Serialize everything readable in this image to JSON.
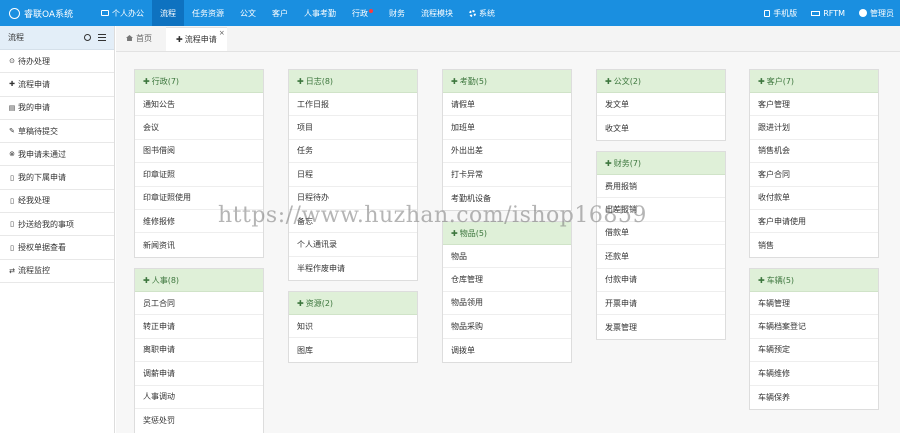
{
  "app": {
    "title": "睿联OA系统"
  },
  "nav": {
    "items": [
      {
        "label": "个人办公",
        "icon": "monitor-icon"
      },
      {
        "label": "流程"
      },
      {
        "label": "任务资源"
      },
      {
        "label": "公文"
      },
      {
        "label": "客户"
      },
      {
        "label": "人事考勤"
      },
      {
        "label": "行政"
      },
      {
        "label": "财务"
      },
      {
        "label": "流程模块"
      },
      {
        "label": "系统",
        "icon": "gear-icon"
      }
    ],
    "right": [
      {
        "label": "手机版",
        "icon": "phone-icon"
      },
      {
        "label": "RFTM",
        "icon": "rftm-icon"
      },
      {
        "label": "管理员",
        "icon": "user-avatar-icon"
      }
    ]
  },
  "sidebar": {
    "title": "流程",
    "items": [
      {
        "label": "待办处理",
        "icon": "⊙"
      },
      {
        "label": "流程申请",
        "icon": "✚"
      },
      {
        "label": "我的申请",
        "icon": "▤"
      },
      {
        "label": "草稿待提交",
        "icon": "✎"
      },
      {
        "label": "我申请未通过",
        "icon": "⊗"
      },
      {
        "label": "我的下属申请",
        "icon": "▯"
      },
      {
        "label": "经我处理",
        "icon": "▯"
      },
      {
        "label": "抄送给我的事项",
        "icon": "▯"
      },
      {
        "label": "授权单据查看",
        "icon": "▯"
      },
      {
        "label": "流程监控",
        "icon": "⇄"
      }
    ]
  },
  "tabs": [
    {
      "label": "首页",
      "icon": "home-icon"
    },
    {
      "label": "流程申请",
      "close": "×"
    }
  ],
  "panels": {
    "xingzheng": {
      "title": "行政(7)",
      "items": [
        "通知公告",
        "会议",
        "图书借阅",
        "印章证照",
        "印章证照使用",
        "维修报修",
        "新闻资讯"
      ]
    },
    "renshi": {
      "title": "人事(8)",
      "items": [
        "员工合同",
        "转正申请",
        "离职申请",
        "调薪申请",
        "人事调动",
        "奖惩处罚"
      ]
    },
    "rizhi": {
      "title": "日志(8)",
      "items": [
        "工作日报",
        "项目",
        "任务",
        "日程",
        "日程待办",
        "备忘",
        "个人通讯录",
        "半程作废申请"
      ]
    },
    "ziyuan": {
      "title": "资源(2)",
      "items": [
        "知识",
        "图库"
      ]
    },
    "kaoqin": {
      "title": "考勤(5)",
      "items": [
        "请假单",
        "加班单",
        "外出出差",
        "打卡异常",
        "考勤机设备"
      ]
    },
    "wupin": {
      "title": "物品(5)",
      "items": [
        "物品",
        "仓库管理",
        "物品领用",
        "物品采购",
        "调拨单"
      ]
    },
    "gongwen": {
      "title": "公文(2)",
      "items": [
        "发文单",
        "收文单"
      ]
    },
    "caiwu": {
      "title": "财务(7)",
      "items": [
        "费用报销",
        "出差报销",
        "借款单",
        "还款单",
        "付款申请",
        "开票申请",
        "发票管理"
      ]
    },
    "kehu": {
      "title": "客户(7)",
      "items": [
        "客户管理",
        "跟进计划",
        "销售机会",
        "客户合同",
        "收付款单",
        "客户申请使用",
        "销售"
      ]
    },
    "cheliang": {
      "title": "车辆(5)",
      "items": [
        "车辆管理",
        "车辆档案登记",
        "车辆预定",
        "车辆维修",
        "车辆保养"
      ]
    }
  },
  "watermark": "https://www.huzhan.com/ishop16859",
  "colors": {
    "topbar": "#1a8fe0",
    "panel_head": "#dff0d8",
    "panel_text": "#3c763d"
  }
}
